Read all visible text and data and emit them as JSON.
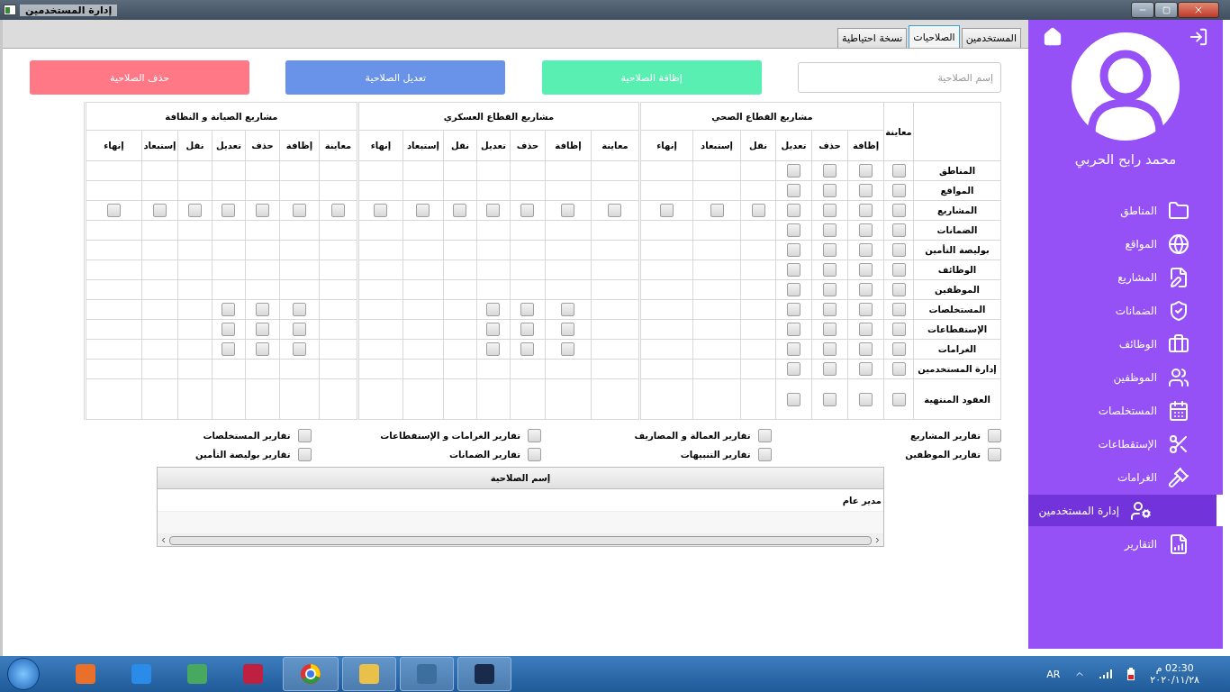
{
  "window": {
    "title": "إدارة المستخدمين"
  },
  "tabs": [
    {
      "label": "المستخدمين",
      "selected": false
    },
    {
      "label": "الصلاحيات",
      "selected": true
    },
    {
      "label": "نسخة احتياطية",
      "selected": false
    }
  ],
  "toolbar": {
    "name_field": {
      "placeholder": "إسم الصلاحية"
    },
    "buttons": [
      {
        "label": "إظافة الصلاحية",
        "kind": "add"
      },
      {
        "label": "تعديل الصلاحية",
        "kind": "edit"
      },
      {
        "label": "حذف الصلاحية",
        "kind": "delete"
      }
    ]
  },
  "permissions": {
    "first_column": "معاينة",
    "groups": [
      {
        "title": "مشاريع القطاع الصحي",
        "columns": [
          "إظافة",
          "حذف",
          "تعديل",
          "نقل",
          "إستبعاد",
          "إنهاء"
        ]
      },
      {
        "title": "مشاريع القطاع العسكري",
        "columns": [
          "معاينة",
          "إظافة",
          "حذف",
          "تعديل",
          "نقل",
          "إستبعاد",
          "إنهاء"
        ]
      },
      {
        "title": "مشاريع الصيانة و النظافة",
        "columns": [
          "معاينة",
          "إظافة",
          "حذف",
          "تعديل",
          "نقل",
          "إستبعاد",
          "إنهاء"
        ]
      }
    ],
    "rows": [
      {
        "label": "المناطق",
        "cells": [
          false,
          false,
          false,
          false,
          null,
          null,
          null,
          null,
          null,
          null,
          null,
          null,
          null,
          null,
          null,
          null,
          null,
          null,
          null,
          null,
          null
        ]
      },
      {
        "label": "المواقع",
        "cells": [
          false,
          false,
          false,
          false,
          null,
          null,
          null,
          null,
          null,
          null,
          null,
          null,
          null,
          null,
          null,
          null,
          null,
          null,
          null,
          null,
          null
        ]
      },
      {
        "label": "المشاريع",
        "cells": [
          false,
          false,
          false,
          false,
          false,
          false,
          false,
          false,
          false,
          false,
          false,
          false,
          false,
          false,
          false,
          false,
          false,
          false,
          false,
          false,
          false
        ]
      },
      {
        "label": "الضمانات",
        "cells": [
          false,
          false,
          false,
          false,
          null,
          null,
          null,
          null,
          null,
          null,
          null,
          null,
          null,
          null,
          null,
          null,
          null,
          null,
          null,
          null,
          null
        ]
      },
      {
        "label": "بوليصة التأمين",
        "cells": [
          false,
          false,
          false,
          false,
          null,
          null,
          null,
          null,
          null,
          null,
          null,
          null,
          null,
          null,
          null,
          null,
          null,
          null,
          null,
          null,
          null
        ]
      },
      {
        "label": "الوظائف",
        "cells": [
          false,
          false,
          false,
          false,
          null,
          null,
          null,
          null,
          null,
          null,
          null,
          null,
          null,
          null,
          null,
          null,
          null,
          null,
          null,
          null,
          null
        ]
      },
      {
        "label": "الموظفين",
        "cells": [
          false,
          false,
          false,
          false,
          null,
          null,
          null,
          null,
          null,
          null,
          null,
          null,
          null,
          null,
          null,
          null,
          null,
          null,
          null,
          null,
          null
        ]
      },
      {
        "label": "المستخلصات",
        "cells": [
          false,
          false,
          false,
          false,
          null,
          null,
          null,
          null,
          false,
          false,
          false,
          null,
          null,
          null,
          null,
          false,
          false,
          false,
          null,
          null,
          null
        ]
      },
      {
        "label": "الإستقطاعات",
        "cells": [
          false,
          false,
          false,
          false,
          null,
          null,
          null,
          null,
          false,
          false,
          false,
          null,
          null,
          null,
          null,
          false,
          false,
          false,
          null,
          null,
          null
        ]
      },
      {
        "label": "الغرامات",
        "cells": [
          false,
          false,
          false,
          false,
          null,
          null,
          null,
          null,
          false,
          false,
          false,
          null,
          null,
          null,
          null,
          false,
          false,
          false,
          null,
          null,
          null
        ]
      },
      {
        "label": "إدارة المستخدمين",
        "cells": [
          false,
          false,
          false,
          false,
          null,
          null,
          null,
          null,
          null,
          null,
          null,
          null,
          null,
          null,
          null,
          null,
          null,
          null,
          null,
          null,
          null
        ]
      },
      {
        "label": "العقود المنتهية",
        "cells": [
          false,
          false,
          false,
          false,
          null,
          null,
          null,
          null,
          null,
          null,
          null,
          null,
          null,
          null,
          null,
          null,
          null,
          null,
          null,
          null,
          null
        ]
      }
    ]
  },
  "reports": [
    {
      "label": "تقارير المشاريع",
      "checked": false
    },
    {
      "label": "تقارير العمالة و المصاريف",
      "checked": false
    },
    {
      "label": "تقارير الغرامات و الإستقطاعات",
      "checked": false
    },
    {
      "label": "تقارير المستخلصات",
      "checked": false
    },
    {
      "label": "تقارير الموظفين",
      "checked": false
    },
    {
      "label": "تقارير التنبيهات",
      "checked": false
    },
    {
      "label": "تقارير الضمانات",
      "checked": false
    },
    {
      "label": "تقارير بوليصة التأمين",
      "checked": false
    }
  ],
  "roles_table": {
    "column": "إسم الصلاحية",
    "rows": [
      "مدير عام"
    ]
  },
  "sidebar": {
    "user_name": "محمد رابح الحربي",
    "items": [
      {
        "label": "المناطق",
        "selected": false
      },
      {
        "label": "المواقع",
        "selected": false
      },
      {
        "label": "المشاريع",
        "selected": false
      },
      {
        "label": "الضمانات",
        "selected": false
      },
      {
        "label": "الوظائف",
        "selected": false
      },
      {
        "label": "الموظفين",
        "selected": false
      },
      {
        "label": "المستخلصات",
        "selected": false
      },
      {
        "label": "الإستقطاعات",
        "selected": false
      },
      {
        "label": "الغرامات",
        "selected": false
      },
      {
        "label": "إدارة المستخدمين",
        "selected": true
      },
      {
        "label": "التقارير",
        "selected": false
      }
    ]
  },
  "taskbar": {
    "language": "AR",
    "time": "02:30 م",
    "date": "٢٠٢٠/١١/٢٨"
  }
}
